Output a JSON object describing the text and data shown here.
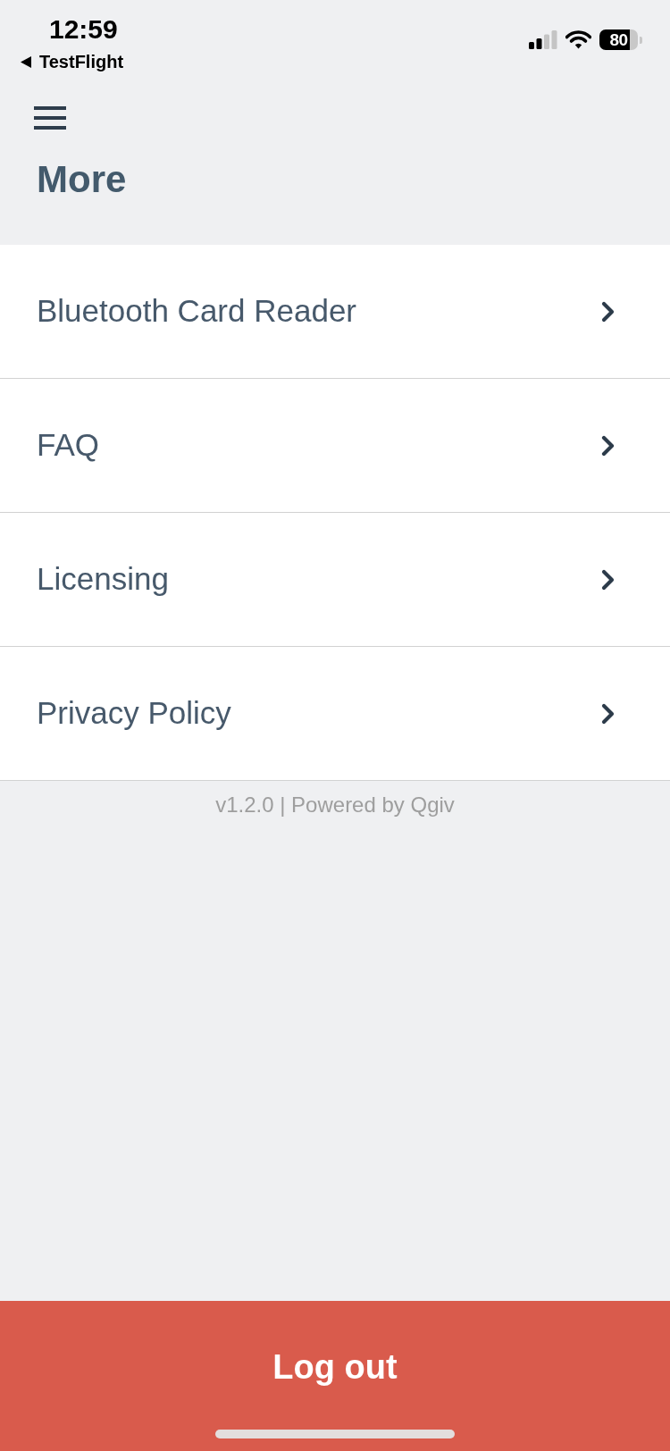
{
  "status_bar": {
    "time": "12:59",
    "back_label": "TestFlight",
    "battery": "80"
  },
  "header": {
    "title": "More"
  },
  "menu": {
    "items": [
      {
        "label": "Bluetooth Card Reader"
      },
      {
        "label": "FAQ"
      },
      {
        "label": "Licensing"
      },
      {
        "label": "Privacy Policy"
      }
    ]
  },
  "footer": {
    "text": "v1.2.0 | Powered by Qgiv"
  },
  "logout_button": {
    "label": "Log out"
  }
}
